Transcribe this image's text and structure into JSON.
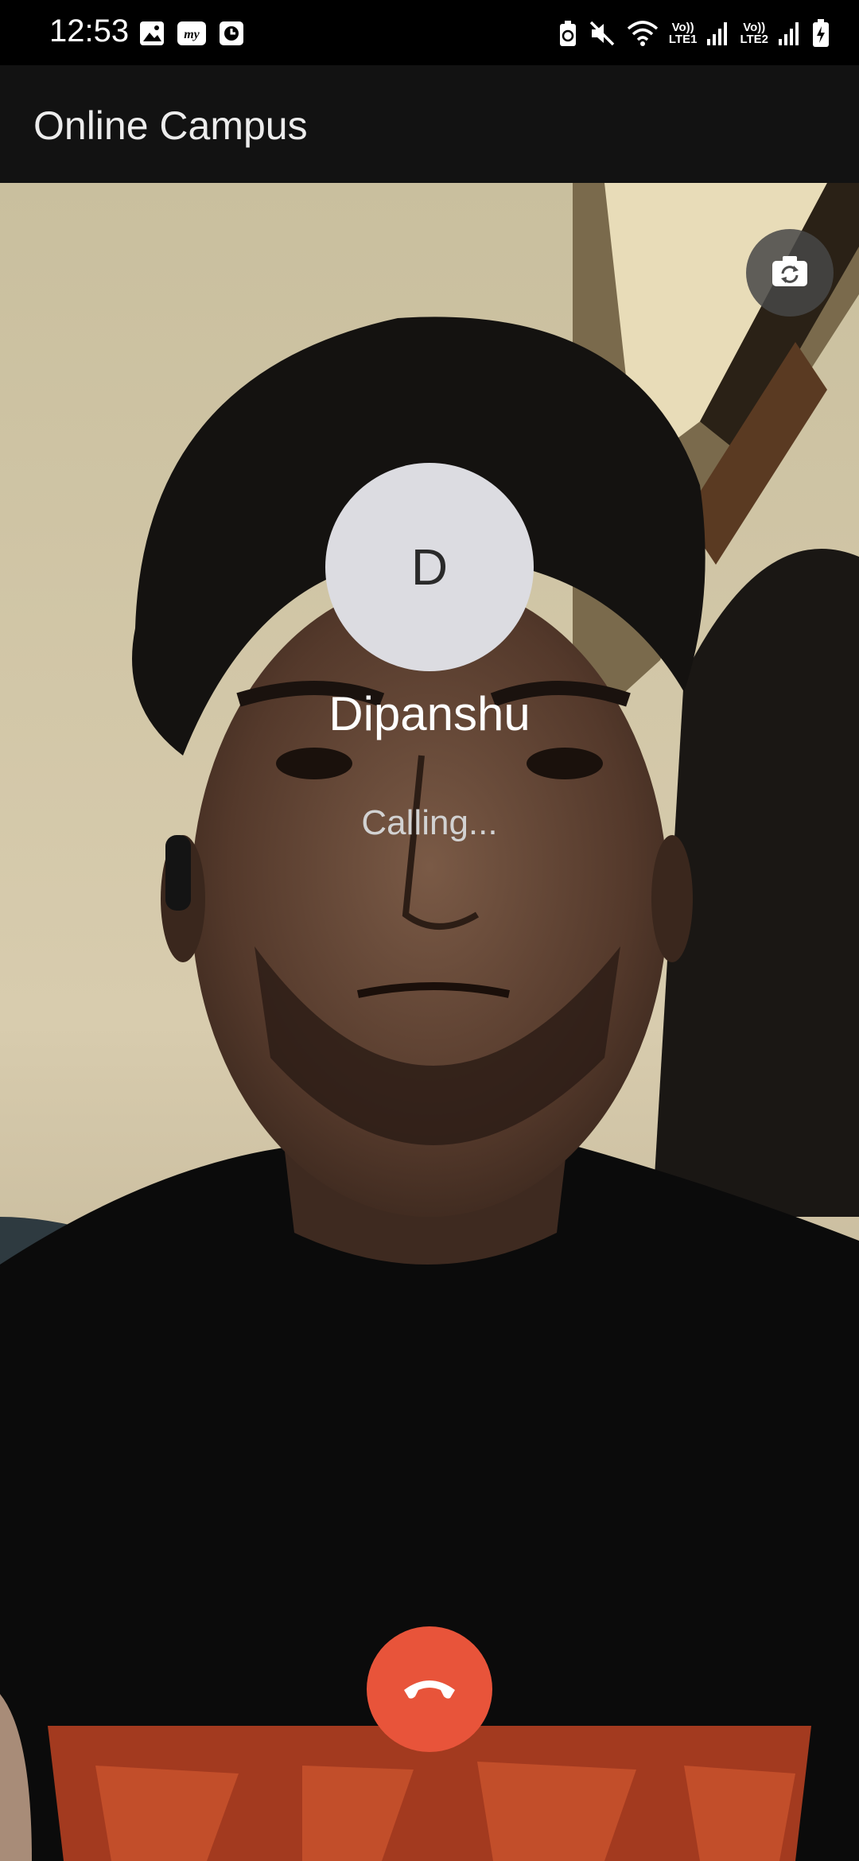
{
  "status_bar": {
    "time": "12:53",
    "left_icons": [
      "gallery-icon",
      "mytoll-app-icon",
      "clock-app-icon"
    ],
    "right_icons": [
      "battery-saver-icon",
      "mute-icon",
      "wifi-icon",
      "signal-sim1-icon",
      "signal-sim2-icon",
      "battery-charging-icon"
    ],
    "sim1_label_top": "Vo))",
    "sim1_label_bottom": "LTE1",
    "sim2_label_top": "Vo))",
    "sim2_label_bottom": "LTE2"
  },
  "app_bar": {
    "title": "Online Campus"
  },
  "call": {
    "avatar_initial": "D",
    "caller_name": "Dipanshu",
    "status": "Calling...",
    "switch_camera_icon": "switch-camera-icon",
    "end_call_icon": "end-call-icon",
    "end_call_color": "#e8543a"
  }
}
